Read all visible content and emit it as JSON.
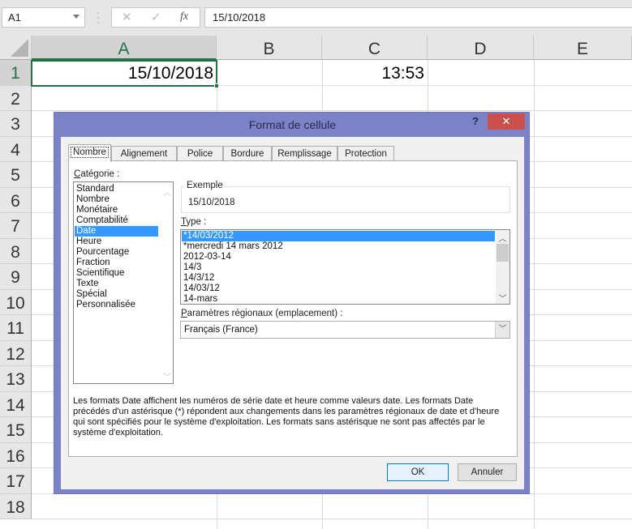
{
  "formula_bar": {
    "name_box": "A1",
    "cancel_icon": "✕",
    "enter_icon": "✓",
    "function_icon": "fx",
    "formula": "15/10/2018"
  },
  "sheet": {
    "columns": [
      "A",
      "B",
      "C",
      "D",
      "E"
    ],
    "selected_column": "A",
    "rows": [
      "1",
      "2",
      "3",
      "4",
      "5",
      "6",
      "7",
      "8",
      "9",
      "10",
      "11",
      "12",
      "13",
      "14",
      "15",
      "16",
      "17",
      "18"
    ],
    "selected_row": "1",
    "cells": {
      "A1": "15/10/2018",
      "C1": "13:53"
    },
    "accent_color": "#217346"
  },
  "dialog": {
    "title": "Format de cellule",
    "help_label": "?",
    "close_label": "✕",
    "tabs": [
      {
        "label": "Nombre",
        "active": true
      },
      {
        "label": "Alignement",
        "active": false
      },
      {
        "label": "Police",
        "active": false
      },
      {
        "label": "Bordure",
        "active": false
      },
      {
        "label": "Remplissage",
        "active": false
      },
      {
        "label": "Protection",
        "active": false
      }
    ],
    "category_label_first": "C",
    "category_label_rest": "atégorie :",
    "categories": [
      "Standard",
      "Nombre",
      "Monétaire",
      "Comptabilité",
      "Date",
      "Heure",
      "Pourcentage",
      "Fraction",
      "Scientifique",
      "Texte",
      "Spécial",
      "Personnalisée"
    ],
    "selected_category": "Date",
    "example_label": "Exemple",
    "example_value": "15/10/2018",
    "type_label_first": "T",
    "type_label_rest": "ype :",
    "types": [
      "*14/03/2012",
      "*mercredi 14 mars 2012",
      "2012-03-14",
      "14/3",
      "14/3/12",
      "14/03/12",
      "14-mars"
    ],
    "selected_type": "*14/03/2012",
    "locale_label_first": "P",
    "locale_label_rest": "aramètres régionaux (emplacement) :",
    "locale_value": "Français (France)",
    "description": "Les formats Date affichent les numéros de série date et heure comme valeurs date. Les formats Date précédés d'un astérisque (*) répondent aux changements dans les paramètres régionaux de date et d'heure qui sont spécifiés pour le système d'exploitation. Les formats sans astérisque ne sont pas affectés par le système d'exploitation.",
    "ok_label": "OK",
    "cancel_label": "Annuler",
    "title_bar_color": "#7b82c7",
    "selection_color": "#3399ff"
  }
}
